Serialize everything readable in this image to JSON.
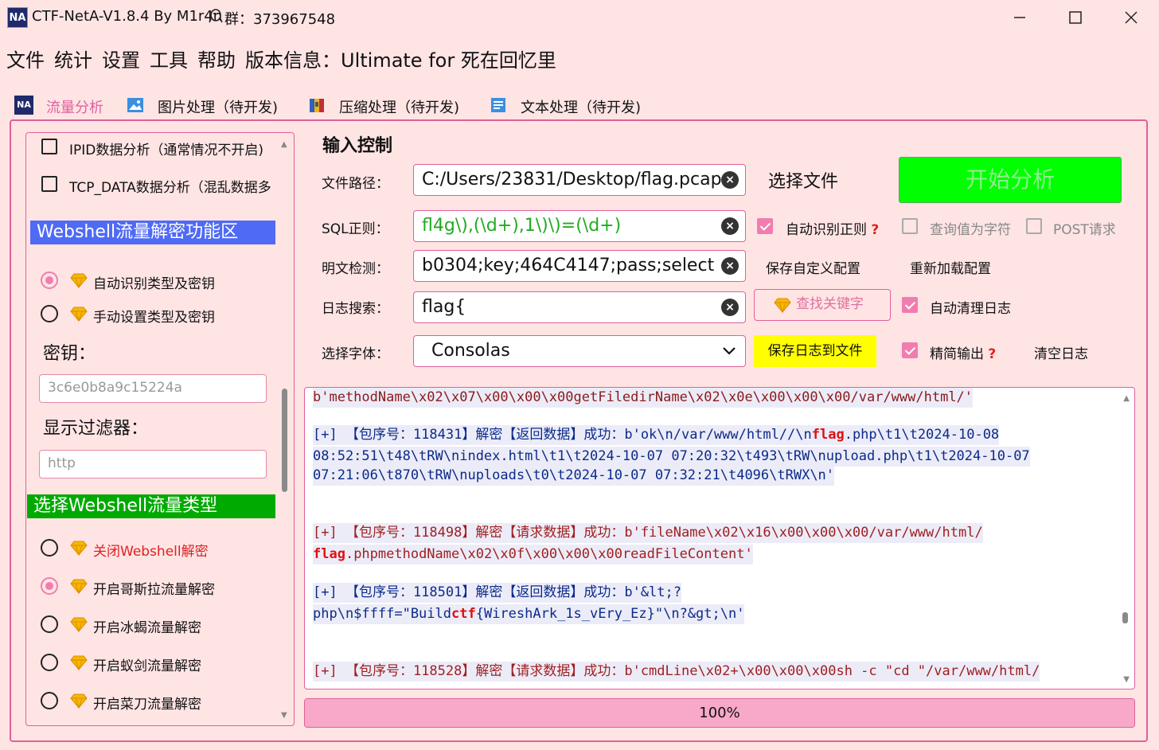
{
  "window": {
    "title": "CTF-NetA-V1.8.4 By M1r4n",
    "group": "群：373967548",
    "logo": "NA"
  },
  "menu": {
    "items": [
      "文件",
      "统计",
      "设置",
      "工具",
      "帮助"
    ],
    "version": "版本信息：Ultimate for 死在回忆里"
  },
  "tabs": [
    {
      "label": "流量分析",
      "active": true,
      "icon": "na-logo-icon"
    },
    {
      "label": "图片处理（待开发)",
      "active": false,
      "icon": "image-icon"
    },
    {
      "label": "压缩处理（待开发)",
      "active": false,
      "icon": "archive-icon"
    },
    {
      "label": "文本处理（待开发)",
      "active": false,
      "icon": "text-doc-icon"
    }
  ],
  "left": {
    "options": [
      {
        "label": "IPID数据分析（通常情况不开启)",
        "checked": false
      },
      {
        "label": "TCP_DATA数据分析（混乱数据多",
        "checked": false
      }
    ],
    "webshell_section": "Webshell流量解密功能区",
    "mode_options": [
      {
        "label": "自动识别类型及密钥",
        "checked": true
      },
      {
        "label": "手动设置类型及密钥",
        "checked": false
      }
    ],
    "key_title": "密钥：",
    "key_placeholder": "3c6e0b8a9c15224a",
    "filter_title": "显示过滤器：",
    "filter_placeholder": "http",
    "type_section": "选择Webshell流量类型",
    "type_options": [
      {
        "label": "关闭Webshell解密",
        "checked": false,
        "red": true
      },
      {
        "label": "开启哥斯拉流量解密",
        "checked": true,
        "red": false
      },
      {
        "label": "开启冰蝎流量解密",
        "checked": false,
        "red": false
      },
      {
        "label": "开启蚁剑流量解密",
        "checked": false,
        "red": false
      },
      {
        "label": "开启菜刀流量解密",
        "checked": false,
        "red": false
      }
    ]
  },
  "input": {
    "heading": "输入控制",
    "file_label": "文件路径：",
    "file_value": "C:/Users/23831/Desktop/flag.pcap",
    "choose_file": "选择文件",
    "start_button": "开始分析",
    "sql_label": "SQL正则：",
    "sql_value": "fl4g\\),(\\d+),1\\)\\)=(\\d+)",
    "auto_regex": "自动识别正则",
    "query_char": "查询值为字符",
    "post_request": "POST请求",
    "plain_label": "明文检测：",
    "plain_value": "b0304;key;464C4147;pass;select",
    "save_config": "保存自定义配置",
    "reload_config": "重新加载配置",
    "log_label": "日志搜索：",
    "log_value": "flag{",
    "find_keyword": "查找关键字",
    "auto_clear": "自动清理日志",
    "font_label": "选择字体：",
    "font_value": "Consolas",
    "save_log": "保存日志到文件",
    "compact": "精简输出",
    "clear_log": "清空日志",
    "qmark": "?"
  },
  "log": {
    "l1": "b'methodName\\x02\\x07\\x00\\x00\\x00getFiledirName\\x02\\x0e\\x00\\x00\\x00/var/www/html/'",
    "l2a": "[+] 【包序号：118431】解密【返回数据】成功：b'ok\\n/var/www/html//\\n",
    "l2kw": "flag",
    "l2b": ".php\\t1\\t2024-10-08",
    "l3": "08:52:51\\t48\\tRW\\nindex.html\\t1\\t2024-10-07 07:20:32\\t493\\tRW\\nupload.php\\t1\\t2024-10-07",
    "l4": "07:21:06\\t870\\tRW\\nuploads\\t0\\t2024-10-07 07:32:21\\t4096\\tRWX\\n'",
    "l5": "[+] 【包序号：118498】解密【请求数据】成功：b'fileName\\x02\\x16\\x00\\x00\\x00/var/www/html/",
    "l6kw": "flag",
    "l6b": ".phpmethodName\\x02\\x0f\\x00\\x00\\x00readFileContent'",
    "l7": "[+] 【包序号：118501】解密【返回数据】成功：b'&lt;?",
    "l8a": "php\\n$ffff=\"Build",
    "l8kw": "ctf",
    "l8b": "{WireshArk_1s_vEry_Ez}\"\\n?&gt;\\n'",
    "l9": "[+] 【包序号：118528】解密【请求数据】成功：b'cmdLine\\x02+\\x00\\x00\\x00sh -c \"cd \"/var/www/html/"
  },
  "progress": {
    "value": 100,
    "text": "100%"
  },
  "colors": {
    "accent": "#e0609a",
    "start": "#00ff00",
    "highlight": "#ffff00",
    "section_blue": "#4f6af5",
    "section_green": "#00aa00"
  }
}
